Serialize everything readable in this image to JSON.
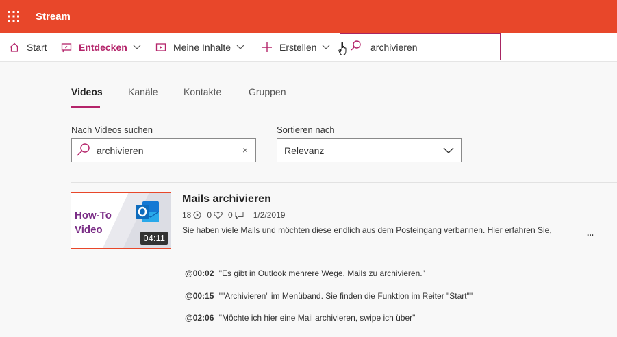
{
  "app": {
    "title": "Stream"
  },
  "nav": {
    "items": [
      {
        "label": "Start",
        "icon": "home-icon"
      },
      {
        "label": "Entdecken",
        "icon": "discover-icon",
        "dropdown": true,
        "active": true
      },
      {
        "label": "Meine Inhalte",
        "icon": "my-content-icon",
        "dropdown": true
      },
      {
        "label": "Erstellen",
        "icon": "plus-icon",
        "dropdown": true
      }
    ],
    "search": {
      "value": "archivieren"
    }
  },
  "tabs": [
    "Videos",
    "Kanäle",
    "Kontakte",
    "Gruppen"
  ],
  "filters": {
    "search_label": "Nach Videos suchen",
    "search_value": "archivieren",
    "clear_glyph": "×",
    "sort_label": "Sortieren nach",
    "sort_value": "Relevanz"
  },
  "result": {
    "thumbnail_text_line1": "How-To",
    "thumbnail_text_line2": "Video",
    "duration": "04:11",
    "title": "Mails archivieren",
    "views": "18",
    "likes": "0",
    "comments": "0",
    "date": "1/2/2019",
    "description": "Sie haben viele Mails und möchten diese endlich aus dem Posteingang verbannen. Hier erfahren Sie,",
    "more": "...",
    "transcript": [
      {
        "time": "@00:02",
        "text": "\"Es gibt in Outlook mehrere Wege, Mails zu archivieren.\""
      },
      {
        "time": "@00:15",
        "text": "\"\"Archivieren\" im Menüband. Sie finden die Funktion im Reiter \"Start\"\""
      },
      {
        "time": "@02:06",
        "text": "\"Möchte ich hier eine Mail archivieren, swipe ich über\""
      }
    ]
  },
  "colors": {
    "brand": "#e8472a",
    "accent": "#b4246a"
  }
}
